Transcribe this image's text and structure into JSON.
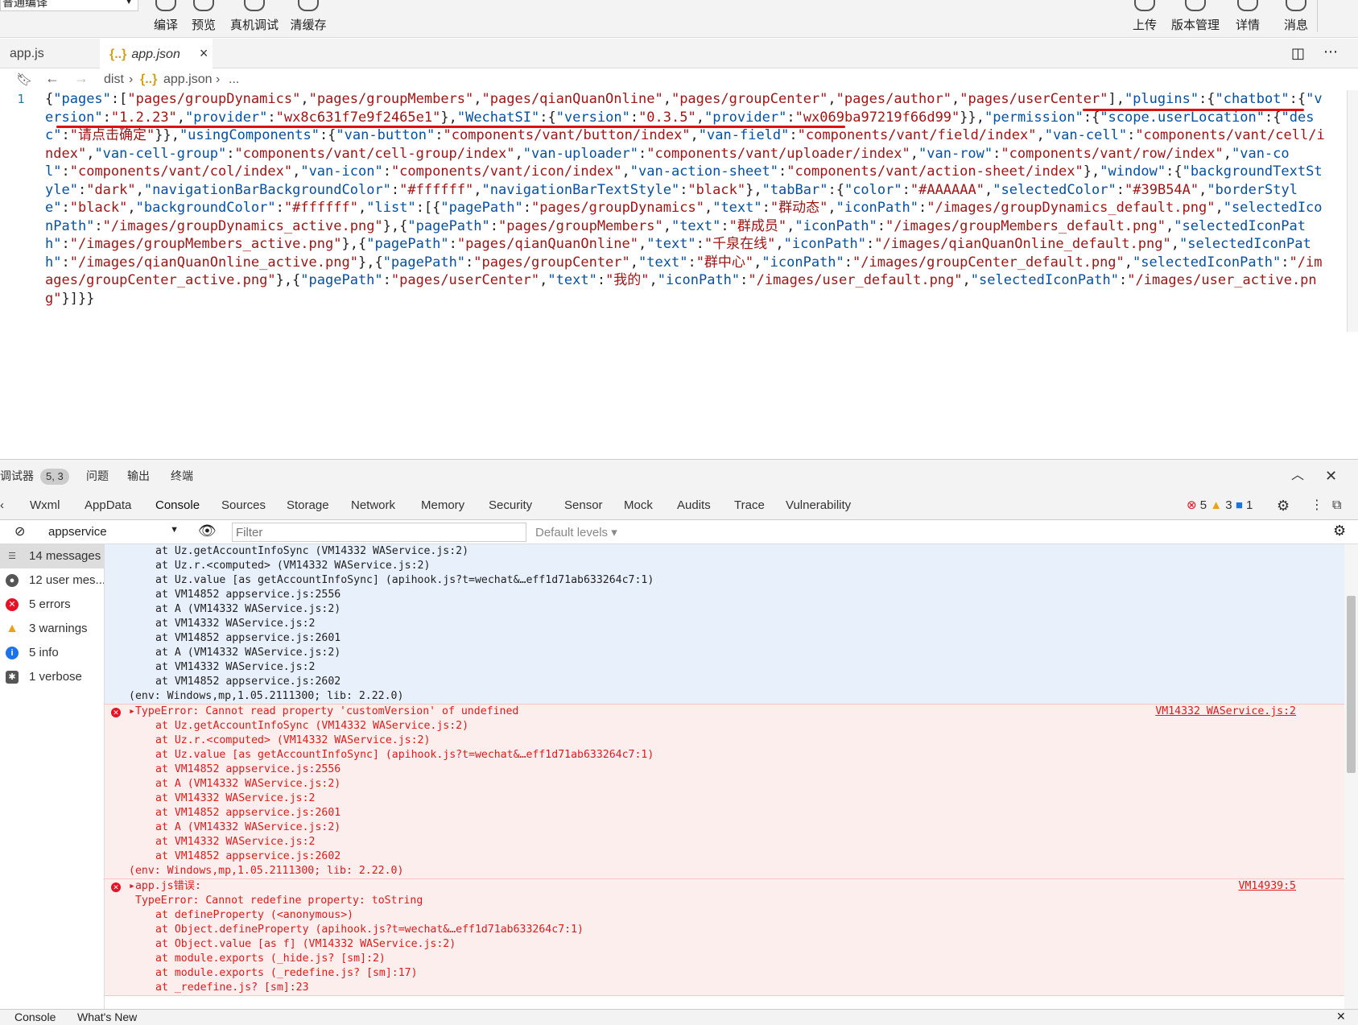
{
  "toolbar": {
    "mode": "普通编译",
    "left_buttons": [
      "编译",
      "预览",
      "真机调试",
      "清缓存"
    ],
    "right_buttons": [
      "上传",
      "版本管理",
      "详情",
      "消息"
    ]
  },
  "tabs": [
    {
      "label": "app.js"
    },
    {
      "label": "app.json",
      "active": true
    }
  ],
  "breadcrumb": {
    "root": "dist",
    "file": "app.json",
    "more": "..."
  },
  "editor": {
    "line_number": "1",
    "code": "{\"pages\":[\"pages/groupDynamics\",\"pages/groupMembers\",\"pages/qianQuanOnline\",\"pages/groupCenter\",\"pages/author\",\"pages/userCenter\"],\"plugins\":{\"chatbot\":{\"version\":\"1.2.23\",\"provider\":\"wx8c631f7e9f2465e1\"},\"WechatSI\":{\"version\":\"0.3.5\",\"provider\":\"wx069ba97219f66d99\"}},\"permission\":{\"scope.userLocation\":{\"desc\":\"请点击确定\"}},\"usingComponents\":{\"van-button\":\"components/vant/button/index\",\"van-field\":\"components/vant/field/index\",\"van-cell\":\"components/vant/cell/index\",\"van-cell-group\":\"components/vant/cell-group/index\",\"van-uploader\":\"components/vant/uploader/index\",\"van-row\":\"components/vant/row/index\",\"van-col\":\"components/vant/col/index\",\"van-icon\":\"components/vant/icon/index\",\"van-action-sheet\":\"components/vant/action-sheet/index\"},\"window\":{\"backgroundTextStyle\":\"dark\",\"navigationBarBackgroundColor\":\"#ffffff\",\"navigationBarTextStyle\":\"black\"},\"tabBar\":{\"color\":\"#AAAAAA\",\"selectedColor\":\"#39B54A\",\"borderStyle\":\"black\",\"backgroundColor\":\"#ffffff\",\"list\":[{\"pagePath\":\"pages/groupDynamics\",\"text\":\"群动态\",\"iconPath\":\"/images/groupDynamics_default.png\",\"selectedIconPath\":\"/images/groupDynamics_active.png\"},{\"pagePath\":\"pages/groupMembers\",\"text\":\"群成员\",\"iconPath\":\"/images/groupMembers_default.png\",\"selectedIconPath\":\"/images/groupMembers_active.png\"},{\"pagePath\":\"pages/qianQuanOnline\",\"text\":\"千泉在线\",\"iconPath\":\"/images/qianQuanOnline_default.png\",\"selectedIconPath\":\"/images/qianQuanOnline_active.png\"},{\"pagePath\":\"pages/groupCenter\",\"text\":\"群中心\",\"iconPath\":\"/images/groupCenter_default.png\",\"selectedIconPath\":\"/images/groupCenter_active.png\"},{\"pagePath\":\"pages/userCenter\",\"text\":\"我的\",\"iconPath\":\"/images/user_default.png\",\"selectedIconPath\":\"/images/user_active.png\"}]}}"
  },
  "debug_panel": {
    "title": "调试器",
    "badge": "5, 3",
    "tabs": [
      "问题",
      "输出",
      "终端"
    ]
  },
  "devtools_tabs": [
    "Wxml",
    "AppData",
    "Console",
    "Sources",
    "Storage",
    "Network",
    "Memory",
    "Security",
    "Sensor",
    "Mock",
    "Audits",
    "Trace",
    "Vulnerability"
  ],
  "counts": {
    "errors": "5",
    "warnings": "3",
    "info": "1"
  },
  "filter": {
    "context": "appservice",
    "placeholder": "Filter",
    "levels": "Default levels"
  },
  "sidebar": [
    {
      "label": "14 messages",
      "icon": "list-icon"
    },
    {
      "label": "12 user mes...",
      "icon": "user-icon"
    },
    {
      "label": "5 errors",
      "icon": "error-icon"
    },
    {
      "label": "3 warnings",
      "icon": "warning-icon"
    },
    {
      "label": "5 info",
      "icon": "info-icon"
    },
    {
      "label": "1 verbose",
      "icon": "bug-icon"
    }
  ],
  "console": {
    "msg1_lines": [
      "at Uz.getAccountInfoSync (VM14332 WAService.js:2)",
      "at Uz.r.<computed> (VM14332 WAService.js:2)",
      "at Uz.value [as getAccountInfoSync] (apihook.js?t=wechat&…eff1d71ab633264c7:1)",
      "at VM14852 appservice.js:2556",
      "at A (VM14332 WAService.js:2)",
      "at VM14332 WAService.js:2",
      "at VM14852 appservice.js:2601",
      "at A (VM14332 WAService.js:2)",
      "at VM14332 WAService.js:2",
      "at VM14852 appservice.js:2602"
    ],
    "env": "(env: Windows,mp,1.05.2111300; lib: 2.22.0)",
    "msg2_head": "TypeError: Cannot read property 'customVersion' of undefined",
    "msg2_src": "VM14332 WAService.js:2",
    "msg3_head": "app.js错误:",
    "msg3_src": "VM14939:5",
    "msg3_sub": "TypeError: Cannot redefine property: toString",
    "msg3_lines": [
      "at defineProperty (<anonymous>)",
      "at Object.defineProperty (apihook.js?t=wechat&…eff1d71ab633264c7:1)",
      "at Object.value [as f] (VM14332 WAService.js:2)",
      "at module.exports (_hide.js? [sm]:2)",
      "at module.exports (_redefine.js? [sm]:17)",
      "at _redefine.js? [sm]:23"
    ]
  },
  "bottom_tabs": [
    "Console",
    "What's New"
  ]
}
